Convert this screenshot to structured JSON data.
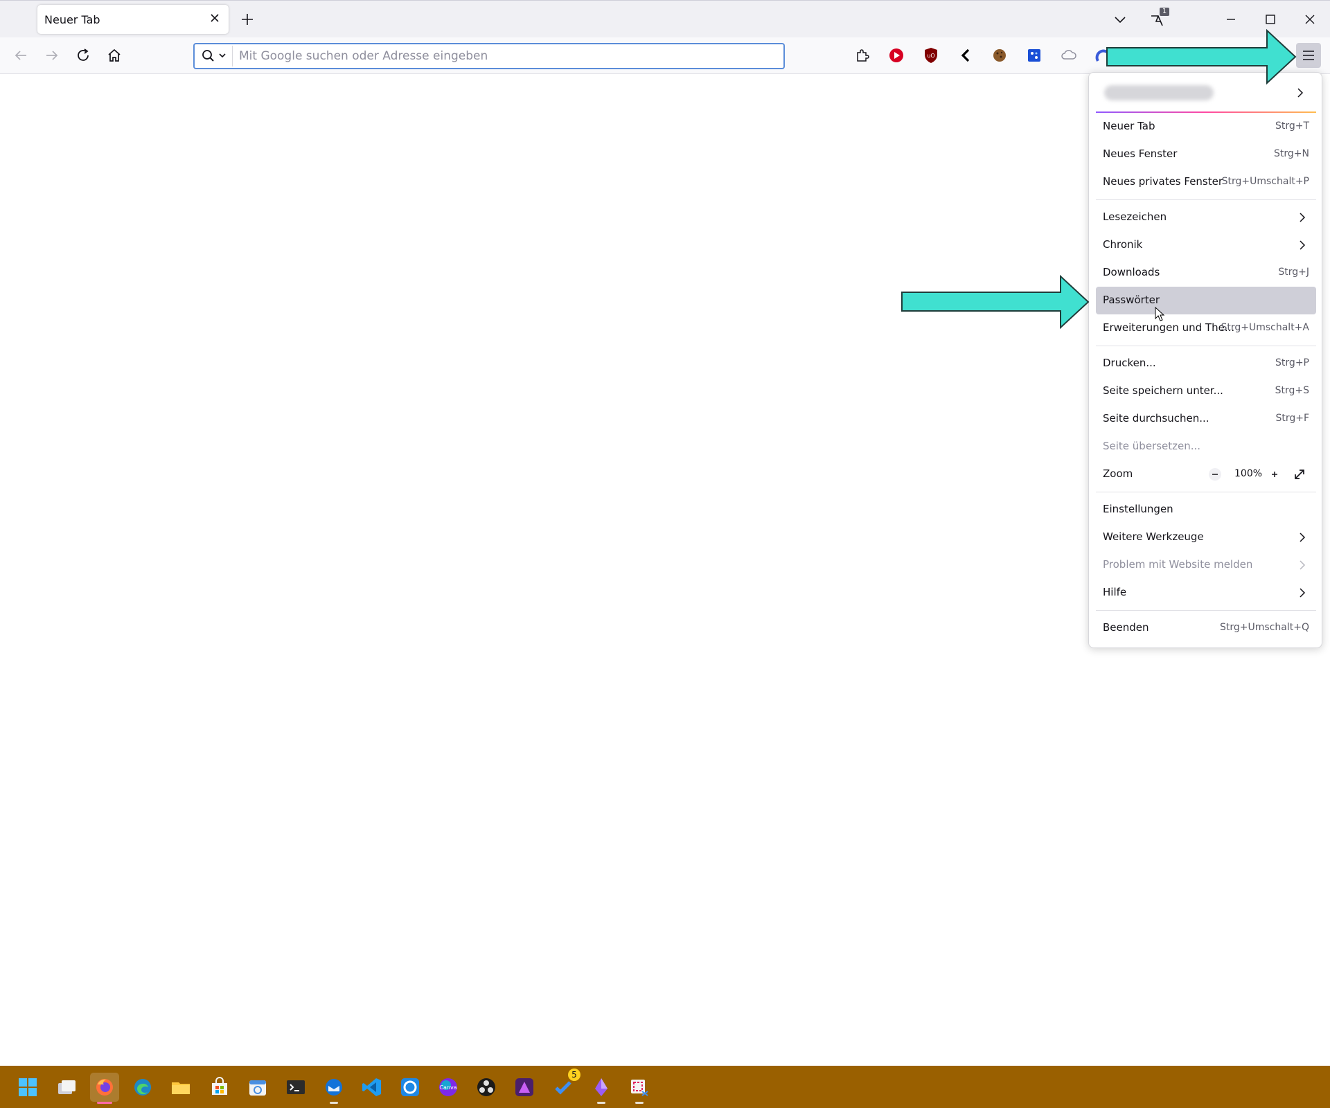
{
  "browser": {
    "tab": {
      "title": "Neuer Tab"
    },
    "list_all_tabs_badge": "1",
    "urlbar": {
      "placeholder": "Mit Google suchen oder Adresse eingeben",
      "value": ""
    },
    "extensions": [
      "extensions-icon",
      "video-player-icon",
      "ublock-origin-icon",
      "back-chevron-icon",
      "cookie-icon",
      "bitwarden-icon",
      "cloud-icon",
      "blue-arc-icon"
    ]
  },
  "app_menu": {
    "items": [
      {
        "label": "Neuer Tab",
        "shortcut": "Strg+T"
      },
      {
        "label": "Neues Fenster",
        "shortcut": "Strg+N"
      },
      {
        "label": "Neues privates Fenster",
        "shortcut": "Strg+Umschalt+P"
      },
      {
        "label": "Lesezeichen",
        "submenu": true
      },
      {
        "label": "Chronik",
        "submenu": true
      },
      {
        "label": "Downloads",
        "shortcut": "Strg+J"
      },
      {
        "label": "Passwörter",
        "highlighted": true
      },
      {
        "label": "Erweiterungen und The...",
        "shortcut": "Strg+Umschalt+A"
      },
      {
        "label": "Drucken...",
        "shortcut": "Strg+P"
      },
      {
        "label": "Seite speichern unter...",
        "shortcut": "Strg+S"
      },
      {
        "label": "Seite durchsuchen...",
        "shortcut": "Strg+F"
      },
      {
        "label": "Seite übersetzen...",
        "disabled": true
      },
      {
        "label": "Zoom",
        "value": "100%"
      },
      {
        "label": "Einstellungen"
      },
      {
        "label": "Weitere Werkzeuge",
        "submenu": true
      },
      {
        "label": "Problem mit Website melden",
        "submenu": true,
        "disabled": true
      },
      {
        "label": "Hilfe",
        "submenu": true
      },
      {
        "label": "Beenden",
        "shortcut": "Strg+Umschalt+Q"
      }
    ]
  },
  "taskbar": {
    "color": "#9a6000",
    "apps": [
      {
        "icon": "windows-start-icon"
      },
      {
        "icon": "task-view-icon"
      },
      {
        "icon": "firefox-icon",
        "active": true
      },
      {
        "icon": "edge-icon"
      },
      {
        "icon": "file-explorer-icon"
      },
      {
        "icon": "microsoft-store-icon"
      },
      {
        "icon": "calendar-icon"
      },
      {
        "icon": "terminal-icon"
      },
      {
        "icon": "thunderbird-icon"
      },
      {
        "icon": "vscode-icon"
      },
      {
        "icon": "sync-app-icon"
      },
      {
        "icon": "canva-icon"
      },
      {
        "icon": "obs-icon"
      },
      {
        "icon": "affinity-photo-icon"
      },
      {
        "icon": "todo-icon",
        "badge": "5"
      },
      {
        "icon": "purple-app-icon"
      },
      {
        "icon": "snipping-tool-icon"
      }
    ]
  },
  "annotations": {
    "arrow_color": "#40e0d0"
  }
}
